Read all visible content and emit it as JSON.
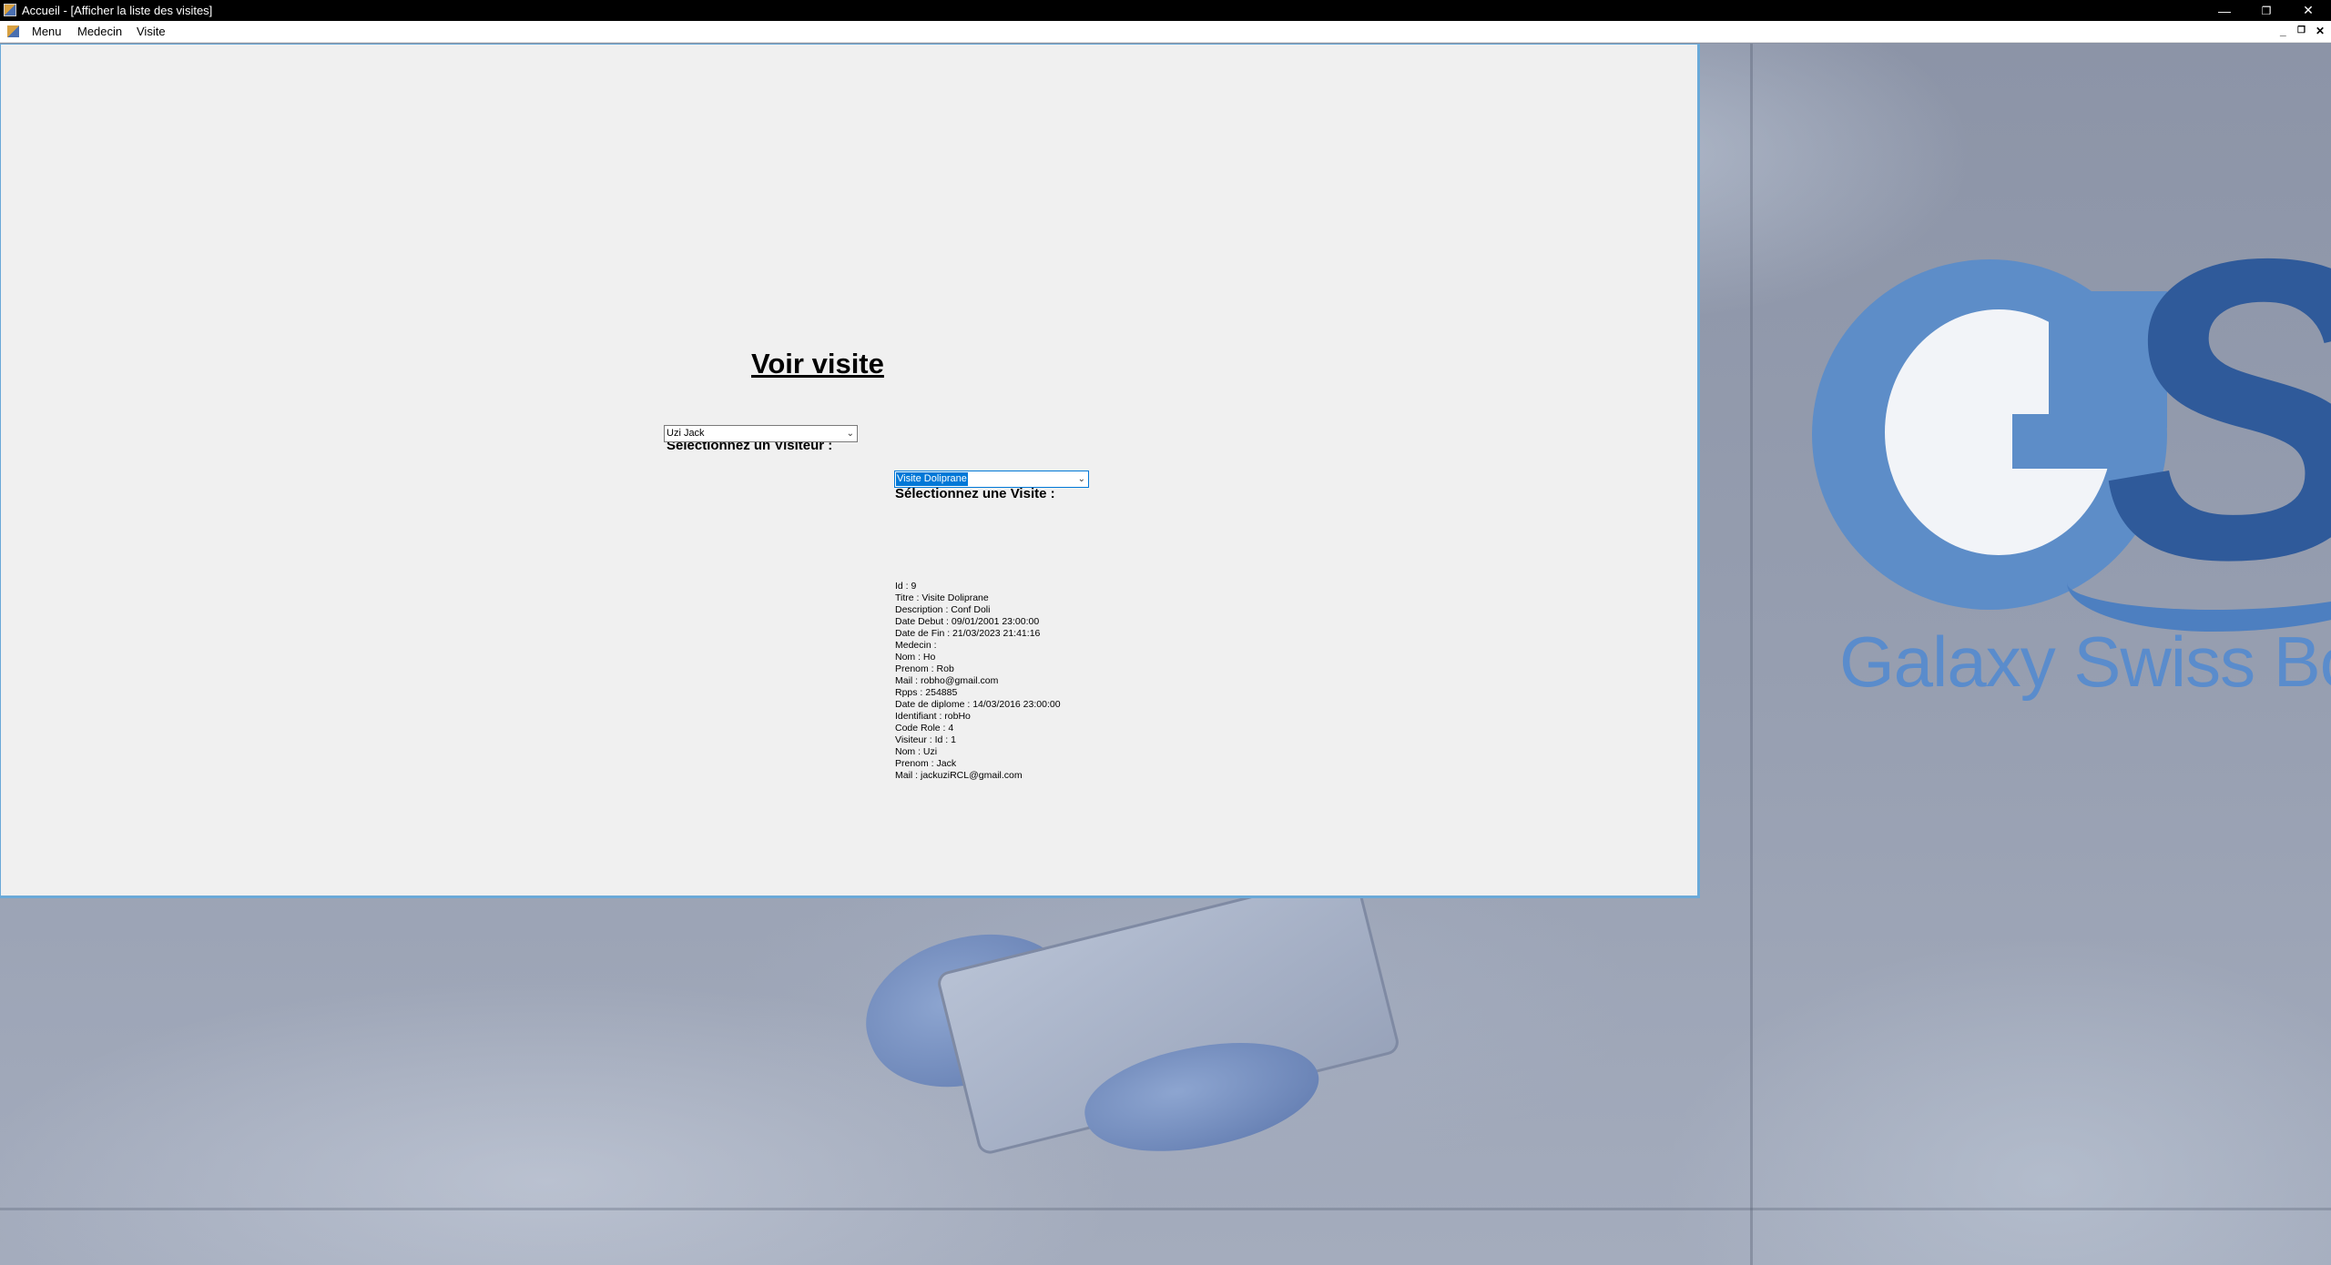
{
  "window": {
    "title": "Accueil - [Afficher la liste des visites]",
    "minimize_icon": "minimize-icon",
    "restore_icon": "restore-icon",
    "close_icon": "close-icon"
  },
  "menubar": {
    "items": [
      {
        "label": "Menu"
      },
      {
        "label": "Medecin"
      },
      {
        "label": "Visite"
      }
    ]
  },
  "form": {
    "title": "Voir visite",
    "visiteur_label": "Sélectionnez un Visiteur :",
    "visiteur_value": "Uzi Jack",
    "visite_label": "Sélectionnez une Visite :",
    "visite_value": "Visite Doliprane",
    "details": [
      "Id : 9",
      "Titre : Visite Doliprane",
      "Description : Conf Doli",
      "Date Debut : 09/01/2001 23:00:00",
      "Date de Fin : 21/03/2023 21:41:16",
      "Medecin :",
      "Nom : Ho",
      "Prenom : Rob",
      "Mail : robho@gmail.com",
      "Rpps : 254885",
      "Date de diplome : 14/03/2016 23:00:00",
      "Identifiant : robHo",
      "Code Role : 4",
      "Visiteur : Id : 1",
      "Nom : Uzi",
      "Prenom : Jack",
      "Mail : jackuziRCL@gmail.com"
    ]
  },
  "background": {
    "logo_tagline": "Galaxy Swiss Bourd"
  },
  "colors": {
    "accent": "#0078d7",
    "form_border": "#6aa9d8",
    "logo_blue": "#5d8dc8",
    "logo_dark_blue": "#2f5a9a"
  }
}
